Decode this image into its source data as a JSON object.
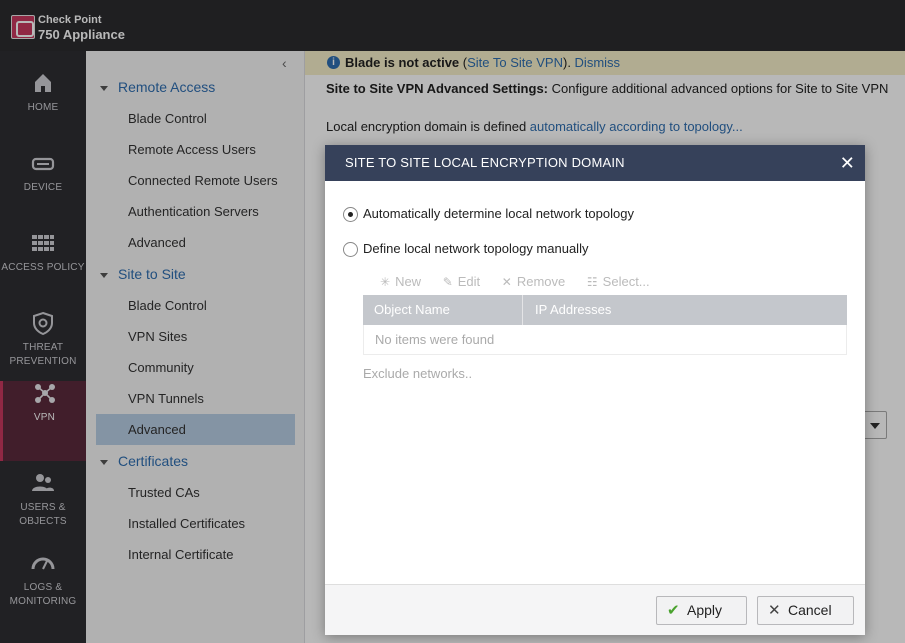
{
  "app": {
    "brand_line1": "Check Point",
    "brand_line2": "750 Appliance"
  },
  "leftnav": {
    "items": [
      {
        "id": "home",
        "label": "HOME",
        "icon": "home-icon"
      },
      {
        "id": "device",
        "label": "DEVICE",
        "icon": "device-icon"
      },
      {
        "id": "access-policy",
        "label": "ACCESS POLICY",
        "icon": "grid-icon"
      },
      {
        "id": "threat-prevention",
        "label": "THREAT PREVENTION",
        "icon": "shield-icon"
      },
      {
        "id": "vpn",
        "label": "VPN",
        "icon": "network-icon",
        "active": true
      },
      {
        "id": "users-objects",
        "label": "USERS & OBJECTS",
        "icon": "users-icon"
      },
      {
        "id": "logs-monitoring",
        "label": "LOGS & MONITORING",
        "icon": "gauge-icon"
      }
    ]
  },
  "tree": {
    "collapse_glyph": "‹",
    "sections": [
      {
        "title": "Remote Access",
        "items": [
          "Blade Control",
          "Remote Access Users",
          "Connected Remote Users",
          "Authentication Servers",
          "Advanced"
        ]
      },
      {
        "title": "Site to Site",
        "items": [
          "Blade Control",
          "VPN Sites",
          "Community",
          "VPN Tunnels",
          "Advanced"
        ]
      },
      {
        "title": "Certificates",
        "items": [
          "Trusted CAs",
          "Installed Certificates",
          "Internal Certificate"
        ]
      }
    ],
    "selected": "Site to Site / Advanced"
  },
  "main": {
    "banner": {
      "bold": "Blade is not active",
      "open_paren": " (",
      "link": "Site To Site VPN",
      "close_paren": "). ",
      "dismiss": "Dismiss"
    },
    "settings_bold": "Site to Site VPN Advanced Settings:",
    "settings_text": " Configure additional advanced options for Site to Site VPN",
    "domain_prefix": "Local encryption domain is defined ",
    "domain_link": "automatically according to topology..."
  },
  "modal": {
    "title": "SITE TO SITE LOCAL ENCRYPTION DOMAIN",
    "close": "✕",
    "radio_auto": "Automatically determine local network topology",
    "radio_manual": "Define local network topology manually",
    "toolbar": {
      "new": "New",
      "edit": "Edit",
      "remove": "Remove",
      "select": "Select..."
    },
    "columns": [
      "Object Name",
      "IP Addresses"
    ],
    "empty": "No items were found",
    "exclude": "Exclude networks..",
    "apply": "Apply",
    "cancel": "Cancel"
  },
  "colors": {
    "accent": "#c8385f",
    "link": "#2f6eb0",
    "modal_header": "#36415a",
    "banner_bg": "#f6efc9",
    "selected_row": "#b8cde4"
  }
}
